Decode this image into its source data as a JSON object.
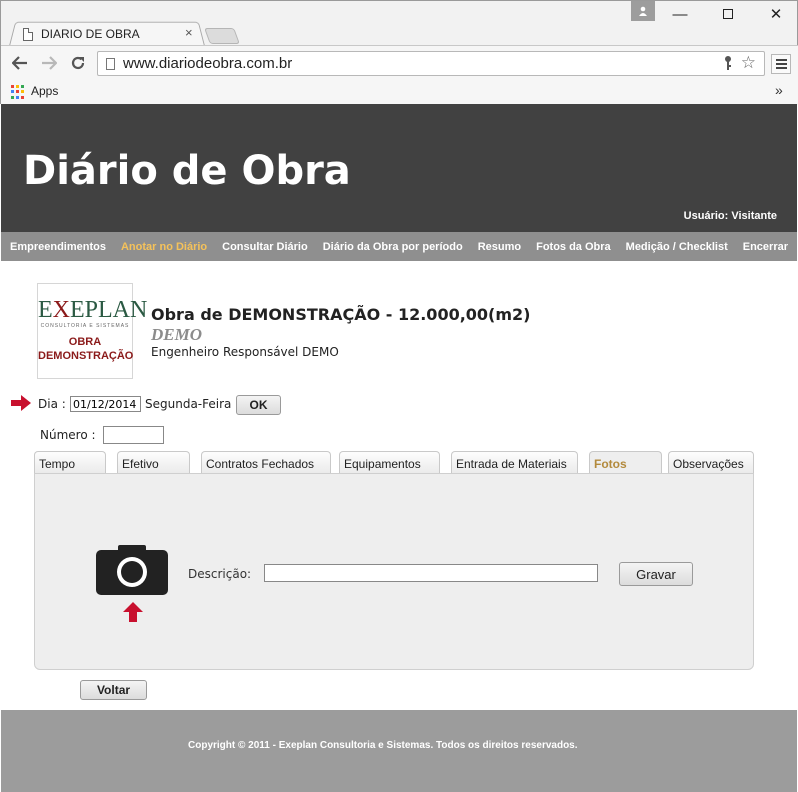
{
  "browser": {
    "tab_title": "DIARIO DE OBRA",
    "tab_close": "×",
    "url": "www.diariodeobra.com.br",
    "bookmarks_apps": "Apps",
    "bookmarks_more": "»",
    "window_minimize": "—",
    "window_close": "✕"
  },
  "header": {
    "title": "Diário de Obra",
    "user": "Usuário: Visitante"
  },
  "menu": {
    "items": [
      "Empreendimentos",
      "Anotar no Diário",
      "Consultar Diário",
      "Diário da Obra por período",
      "Resumo",
      "Fotos da Obra",
      "Medição / Checklist",
      "Encerrar"
    ],
    "active_index": 1,
    "active_color": "#f5c25a"
  },
  "logo": {
    "brand_e": "E",
    "brand_x": "X",
    "brand_rest": "EPLAN",
    "subtitle": "CONSULTORIA E SISTEMAS",
    "obra_line1": "OBRA",
    "obra_line2": "DEMONSTRAÇÃO"
  },
  "obra": {
    "title": "Obra de DEMONSTRAÇÃO - 12.000,00(m2)",
    "tag": "DEMO",
    "engineer": "Engenheiro Responsável DEMO"
  },
  "form": {
    "dia_label": "Dia :",
    "dia_value": "01/12/2014",
    "weekday": "Segunda-Feira",
    "ok_label": "OK",
    "numero_label": "Número :",
    "numero_value": ""
  },
  "tabs": {
    "items": [
      "Tempo",
      "Efetivo",
      "Contratos Fechados",
      "Equipamentos",
      "Entrada de Materiais",
      "Fotos",
      "Observações"
    ],
    "active_index": 5
  },
  "fotos": {
    "descricao_label": "Descrição:",
    "descricao_value": "",
    "gravar_label": "Gravar"
  },
  "actions": {
    "voltar_label": "Voltar"
  },
  "footer": {
    "copyright": "Copyright © 2011 - Exeplan Consultoria e Sistemas. Todos os direitos reservados."
  },
  "colors": {
    "header_bg": "#414141",
    "menubar_bg": "#8f8f8f",
    "active_tab_text": "#b38a3c",
    "arrow_red": "#c8102e",
    "footer_bg": "#9c9c9c"
  }
}
